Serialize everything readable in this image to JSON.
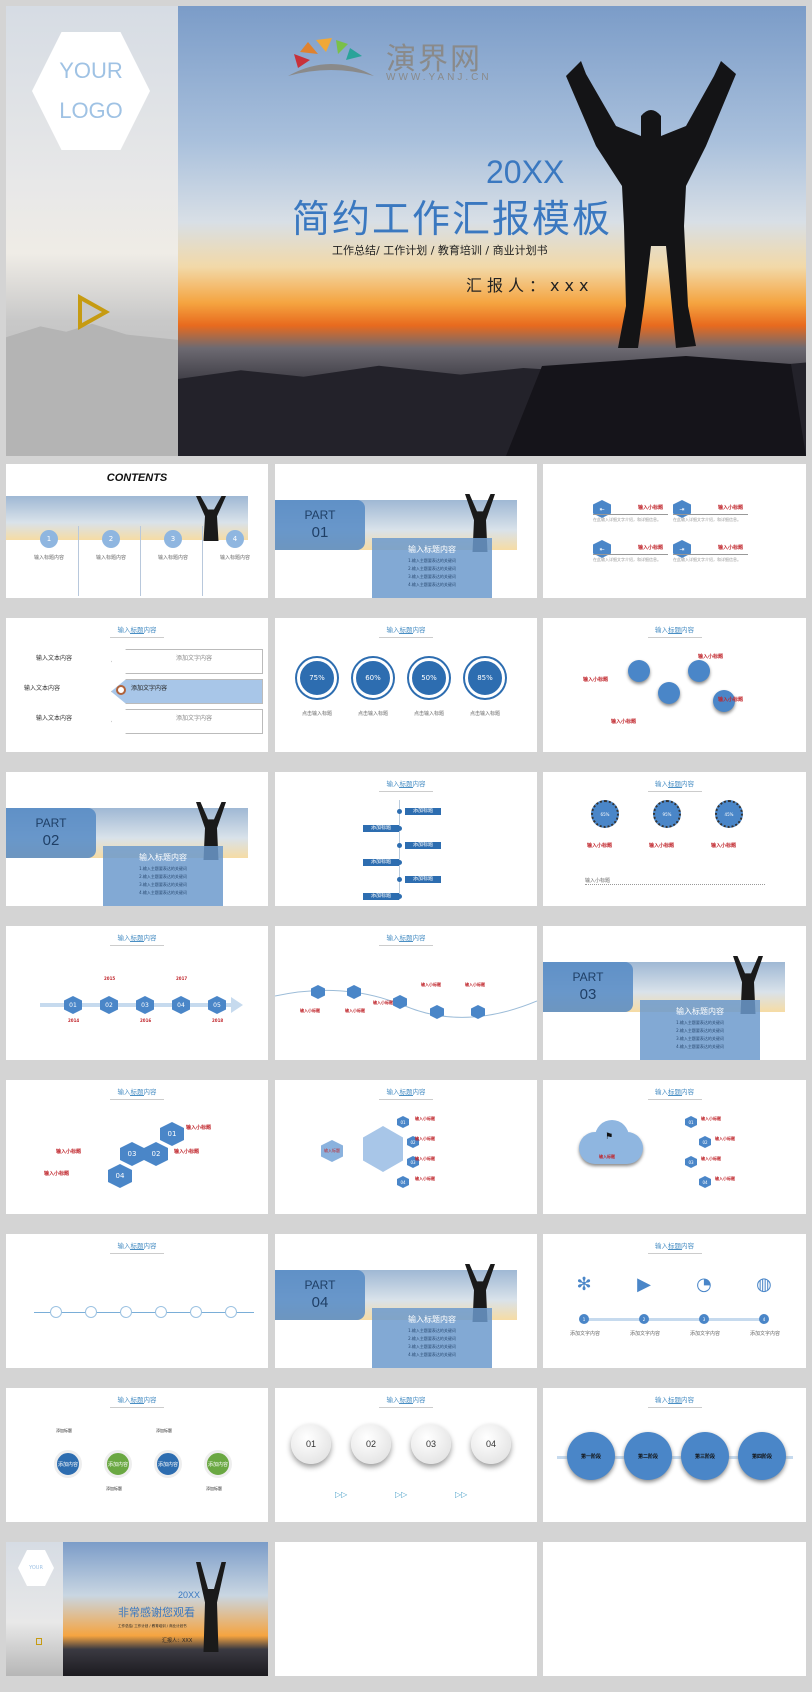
{
  "cover": {
    "logo_line1": "YOUR",
    "logo_line2": "LOGO",
    "watermark_name": "演界网",
    "watermark_url": "WWW.YANJ.CN",
    "year": "20XX",
    "title": "简约工作汇报模板",
    "subtitle": "工作总结/ 工作计划 / 教育培训 / 商业计划书",
    "reporter": "汇报人：xxx",
    "play_icon": "play-triangle-icon"
  },
  "slides": {
    "section_title": "输入标题内容",
    "contents": {
      "heading": "CONTENTS",
      "items": [
        {
          "num": "1",
          "label": "输入标题内容"
        },
        {
          "num": "2",
          "label": "输入标题内容"
        },
        {
          "num": "3",
          "label": "输入标题内容"
        },
        {
          "num": "4",
          "label": "输入标题内容"
        }
      ]
    },
    "parts": [
      {
        "label": "PART",
        "num": "01"
      },
      {
        "label": "PART",
        "num": "02"
      },
      {
        "label": "PART",
        "num": "03"
      },
      {
        "label": "PART",
        "num": "04"
      }
    ],
    "part_box": {
      "title": "输入标题内容",
      "lines": [
        "1.输入主题要表达的关键词",
        "2.输入主题要表达的关键词",
        "3.输入主题要表达的关键词",
        "4.输入主题要表达的关键词"
      ]
    },
    "small_title": "输入小标题",
    "small_desc": "在此输入详细文字介绍，和详细信息。",
    "arrows": {
      "left_items": [
        "输入文本内容",
        "输入文本内容",
        "输入文本内容"
      ],
      "right_items": [
        "添加文字内容",
        "添加文字内容",
        "添加文字内容"
      ]
    },
    "progress": {
      "values": [
        "75%",
        "60%",
        "50%",
        "85%"
      ],
      "label": "点击输入标题"
    },
    "dials": {
      "values": [
        "65%",
        "95%",
        "45%"
      ]
    },
    "timeline_years": [
      "2014",
      "2015",
      "2016",
      "2017",
      "2018"
    ],
    "timeline_nums": [
      "01",
      "02",
      "03",
      "04",
      "05"
    ],
    "hex_nums": [
      "01",
      "02",
      "03",
      "04"
    ],
    "add_title": "添加标题",
    "cloud_label": "输入标题",
    "hex_center_label": "输入标题",
    "icons_row": {
      "icons": [
        "fan-icon",
        "play-circle-icon",
        "clock-icon",
        "globe-icon"
      ],
      "nums": [
        "1",
        "2",
        "3",
        "4"
      ],
      "label": "添加文字内容"
    },
    "wave": {
      "circle_label": "添加内容",
      "title": "添加标题"
    },
    "buttons_3d": {
      "nums": [
        "01",
        "02",
        "03",
        "04"
      ]
    },
    "stages": [
      "第一阶段",
      "第二阶段",
      "第三阶段",
      "第四阶段"
    ],
    "closing": {
      "year": "20XX",
      "title": "非常感谢您观看",
      "subtitle": "工作总结/ 工作计划 / 教育培训 / 商业计划书",
      "reporter": "汇报人：XXX"
    }
  },
  "colors": {
    "accent_blue": "#3a78c0",
    "hex_blue": "#4a86c8",
    "red_label": "#c0262c",
    "gold": "#c69b12",
    "green": "#6aa842"
  }
}
